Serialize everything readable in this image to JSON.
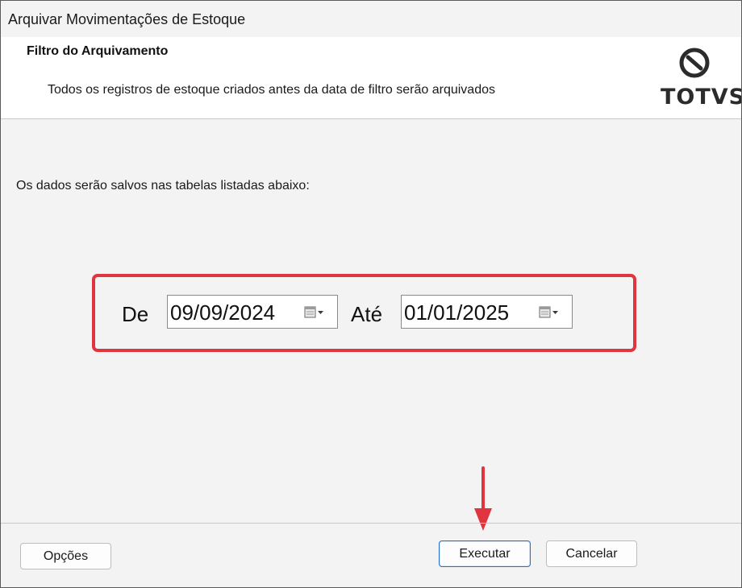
{
  "window": {
    "title": "Arquivar Movimentações de Estoque"
  },
  "header": {
    "title": "Filtro do Arquivamento",
    "description": "Todos os registros de estoque criados antes da data de filtro serão arquivados",
    "logo_text": "TOTVS"
  },
  "main": {
    "info": "Os dados serão salvos nas tabelas listadas abaixo:",
    "from_label": "De",
    "from_value": "09/09/2024",
    "to_label": "Até",
    "to_value": "01/01/2025",
    "highlight_color": "#e0343f"
  },
  "footer": {
    "options_label": "Opções",
    "execute_label": "Executar",
    "cancel_label": "Cancelar"
  },
  "icons": [
    "totvs-logo-icon",
    "calendar-icon",
    "dropdown-arrow-icon",
    "red-arrow-icon"
  ]
}
